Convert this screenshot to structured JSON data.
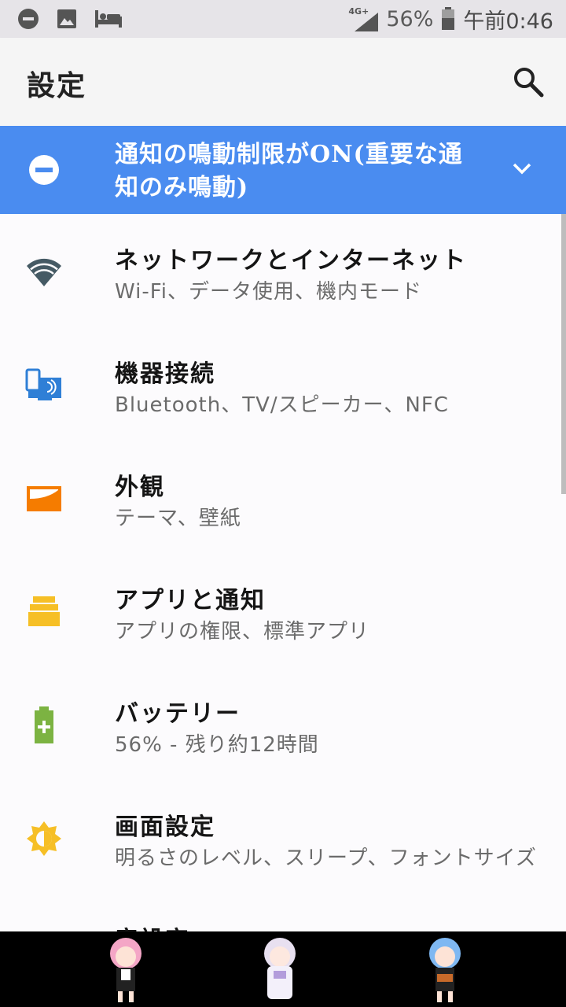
{
  "status_bar": {
    "network": "4G+",
    "battery": "56%",
    "time": "午前0:46",
    "left_icons": [
      "dnd-status-icon",
      "image-icon",
      "bed-icon"
    ]
  },
  "app_bar": {
    "title": "設定"
  },
  "dnd_banner": {
    "text": "通知の鳴動制限がON(重要な通知のみ鳴動)"
  },
  "settings": [
    {
      "title": "ネットワークとインターネット",
      "subtitle": "Wi-Fi、データ使用、機内モード",
      "icon": "wifi-icon",
      "color": "#455a64"
    },
    {
      "title": "機器接続",
      "subtitle": "Bluetooth、TV/スピーカー、NFC",
      "icon": "device-connection-icon",
      "color": "#2f7fd6"
    },
    {
      "title": "外観",
      "subtitle": "テーマ、壁紙",
      "icon": "wallpaper-icon",
      "color": "#f57c00"
    },
    {
      "title": "アプリと通知",
      "subtitle": "アプリの権限、標準アプリ",
      "icon": "apps-icon",
      "color": "#f6bf26"
    },
    {
      "title": "バッテリー",
      "subtitle": "56% - 残り約12時間",
      "icon": "battery-charging-icon",
      "color": "#7cb342"
    },
    {
      "title": "画面設定",
      "subtitle": "明るさのレベル、スリープ、フォントサイズ",
      "icon": "brightness-icon",
      "color": "#f6bf26"
    },
    {
      "title": "音設定",
      "subtitle": "",
      "icon": "sound-icon",
      "color": "#555555"
    }
  ],
  "colors": {
    "accent": "#4a8cf0",
    "status_bar": "#e6e4e8",
    "app_bar": "#f5f5f5"
  }
}
